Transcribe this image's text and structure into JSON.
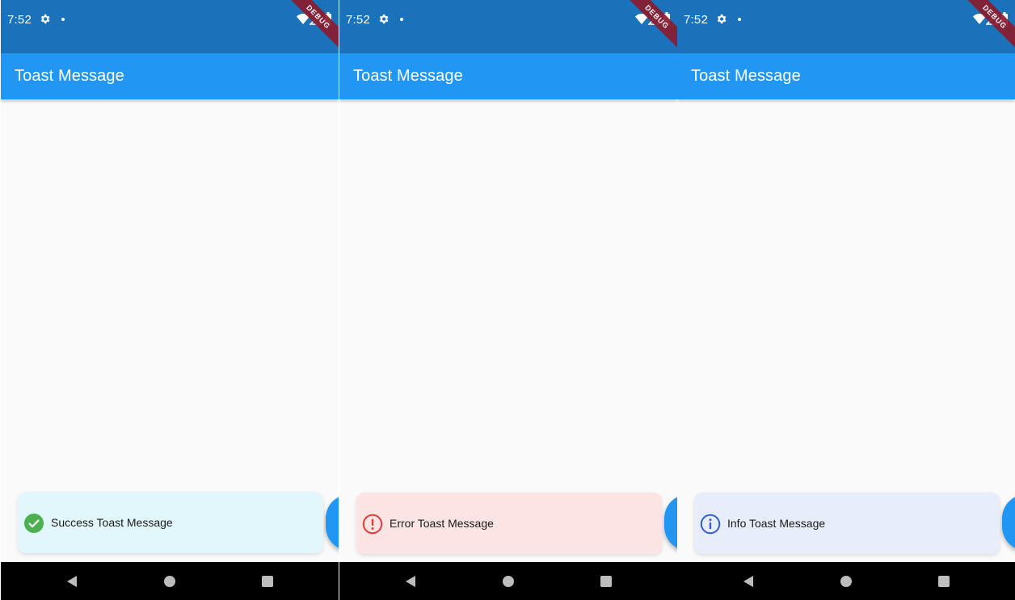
{
  "status_bar": {
    "time": "7:52",
    "background": "#1a72ba",
    "icons": [
      "gear-icon",
      "dot-icon",
      "wifi-icon",
      "signal-icon",
      "battery-icon"
    ]
  },
  "debug_banner": "DEBUG",
  "app_bar": {
    "title": "Toast Message",
    "color": "#2196f3"
  },
  "screens": [
    {
      "toast": {
        "kind": "success",
        "icon": "check-circle-icon",
        "message": "Success Toast Message",
        "background": "#e1f7fc",
        "accent": "#4caf50"
      }
    },
    {
      "toast": {
        "kind": "error",
        "icon": "error-circle-icon",
        "message": "Error Toast Message",
        "background": "#fde4e4",
        "accent": "#e53935"
      }
    },
    {
      "toast": {
        "kind": "info",
        "icon": "info-circle-icon",
        "message": "Info Toast Message",
        "background": "#e8edfb",
        "accent": "#2f5fd0"
      }
    }
  ],
  "nav_bar": {
    "icons": [
      "back-icon",
      "home-icon",
      "recents-icon"
    ]
  }
}
